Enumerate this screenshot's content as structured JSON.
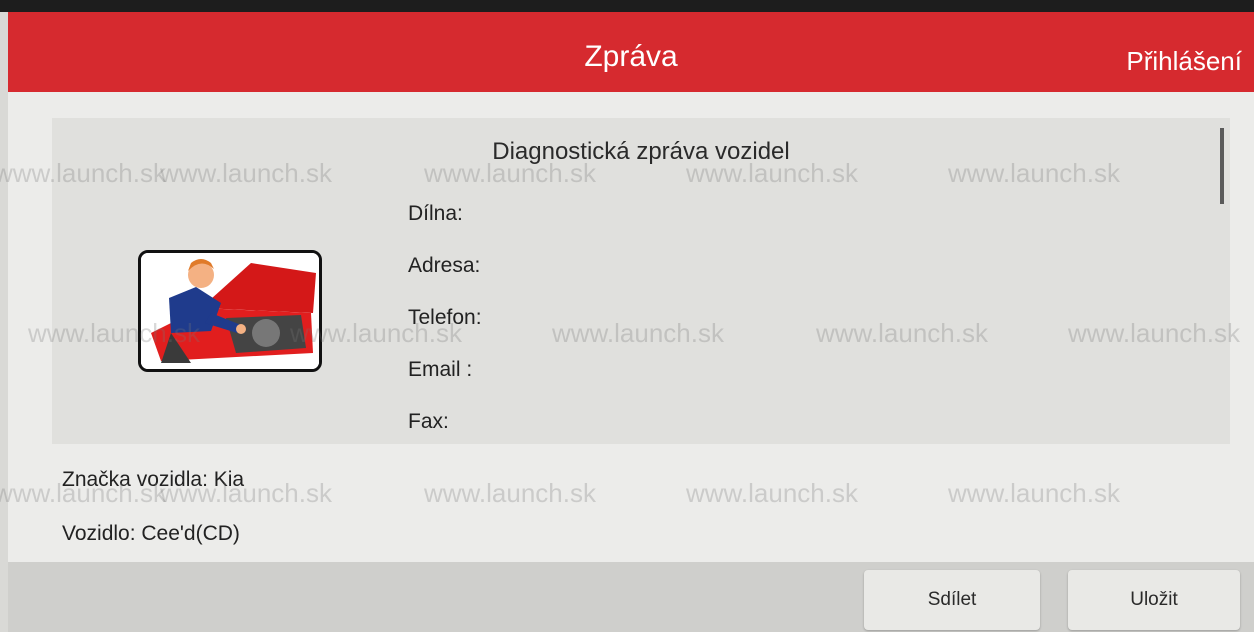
{
  "header": {
    "title": "Zpráva",
    "login_label": "Přihlášení"
  },
  "report": {
    "title": "Diagnostická zpráva vozidel",
    "fields": [
      "Dílna:",
      "Adresa:",
      "Telefon:",
      "Email :",
      "Fax:"
    ],
    "logo_icon": "mechanic-illustration-icon"
  },
  "vehicle": {
    "brand_line": "Značka vozidla: Kia",
    "model_line": "Vozidlo: Cee'd(CD)"
  },
  "actions": {
    "share_label": "Sdílet",
    "save_label": "Uložit"
  },
  "watermark": "www.launch.sk",
  "colors": {
    "header_red": "#d62a2f",
    "content_bg": "#ececea",
    "card_bg": "#e0e0dd"
  }
}
